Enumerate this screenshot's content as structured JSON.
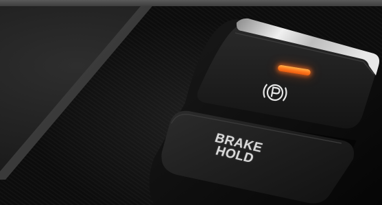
{
  "image": {
    "subject": "car-center-console-switches"
  },
  "switches": {
    "parking_brake": {
      "icon": "parking-brake-icon",
      "indicator_color": "#ff7a1e"
    },
    "brake_hold": {
      "label": "BRAKE\nHOLD"
    }
  },
  "colors": {
    "console_dark": "#111111",
    "chrome_trim": "#d8d8d8",
    "button_face": "#1e1e1e",
    "label_text": "#d9d9d9"
  }
}
